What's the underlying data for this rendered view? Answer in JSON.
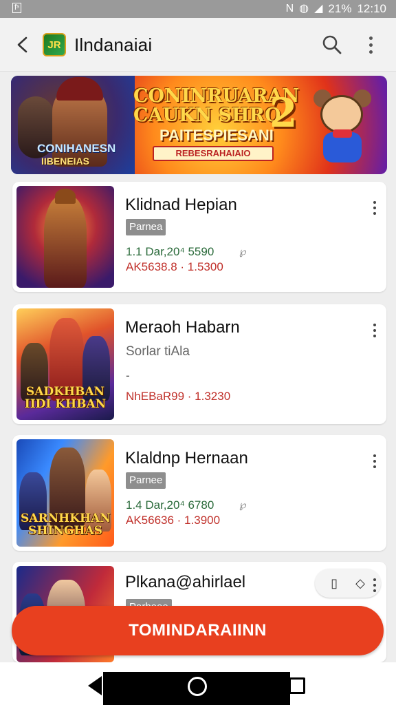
{
  "status_bar": {
    "left_icon": "notification-icon",
    "battery_text": "21%",
    "time": "12:10",
    "icons": [
      "nfc-icon",
      "wifi-icon",
      "signal-icon",
      "battery-icon"
    ]
  },
  "app_bar": {
    "title": "Ilndanaiai",
    "logo_text": "JR",
    "back_icon": "back-arrow-icon",
    "search_icon": "search-icon",
    "more_icon": "more-vertical-icon"
  },
  "banner": {
    "title": "CONINRUARAN CAUKN SHRO",
    "number": "2",
    "subtitle": "PAITESPIESANI",
    "ribbon": "REBESRAHAIAIO",
    "left_text_1": "CONIHANESN",
    "left_text_2": "IIBENEIAS"
  },
  "games": [
    {
      "name": "Klidnad Hepian",
      "badge": "Parnea",
      "meta_1": "1.1 Dar,20⁴ 5590",
      "meta_2": "AK5638.8 · 1.5300",
      "small_icon": "℘",
      "thumb_caption": ""
    },
    {
      "name": "Meraoh Habarn",
      "subtitle": "Sorlar tiAla",
      "dash": "-",
      "meta_2": "NhEBaR99 · 1.3230",
      "thumb_caption": "SADKHBAN IIDI KHBAN"
    },
    {
      "name": "Klaldnp Hernaan",
      "badge": "Parnee",
      "meta_1": "1.4 Dar,20⁴ 6780",
      "meta_2": "AK56636 · 1.3900",
      "small_icon": "℘",
      "thumb_caption": "SARNHKHAN SHINGHAS"
    },
    {
      "name": "Plkana@ahirlael",
      "badge": "Parbeee",
      "thumb_caption": "",
      "pill_icons": [
        "thumb-icon",
        "diamond-icon"
      ]
    }
  ],
  "cta": {
    "label": "TOMINDARAIINN"
  },
  "colors": {
    "cta": "#e8401f",
    "badge": "#8e8e8e",
    "meta_green": "#2a6a3a",
    "meta_red": "#c0302a"
  }
}
